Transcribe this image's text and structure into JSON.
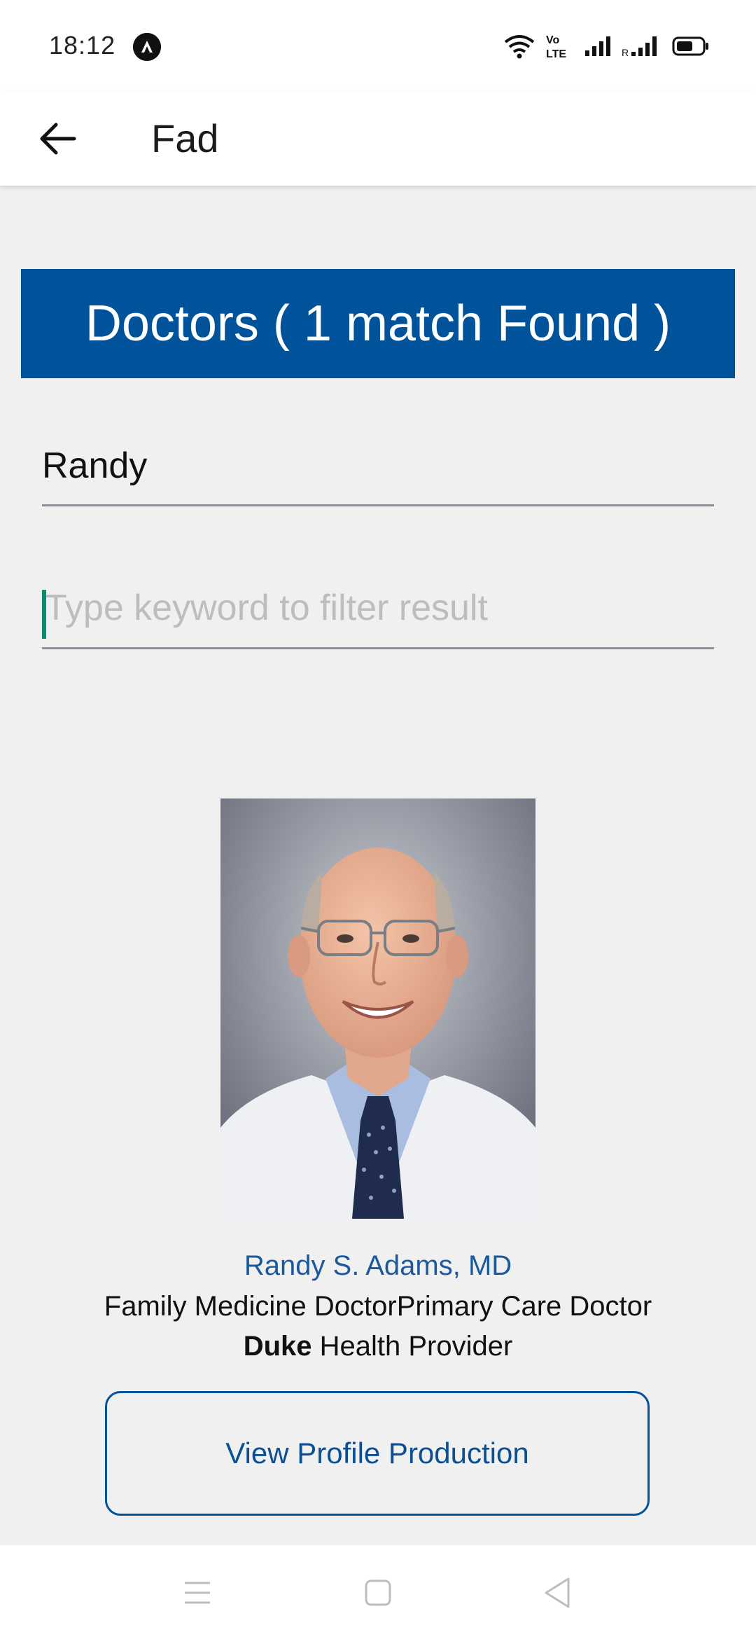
{
  "status_bar": {
    "time": "18:12",
    "icons": [
      "app-notification-icon",
      "wifi-icon",
      "volte-icon",
      "signal-icon",
      "roaming-signal-icon",
      "battery-icon"
    ],
    "volte_text": "Vo LTE"
  },
  "app_bar": {
    "title": "Fad",
    "back_icon": "arrow-back-icon"
  },
  "results_banner": {
    "text": "Doctors ( 1 match Found )",
    "color": "#00539b"
  },
  "search": {
    "value": "Randy"
  },
  "filter": {
    "value": "",
    "placeholder": "Type keyword to filter result"
  },
  "doctor": {
    "name": "Randy S. Adams, MD",
    "specialty": "Family Medicine DoctorPrimary Care Doctor",
    "provider_bold": "Duke",
    "provider_rest": " Health Provider",
    "button_label": "View Profile Production"
  },
  "nav_bar": {
    "icons": [
      "menu-icon",
      "home-square-icon",
      "back-triangle-icon"
    ]
  }
}
